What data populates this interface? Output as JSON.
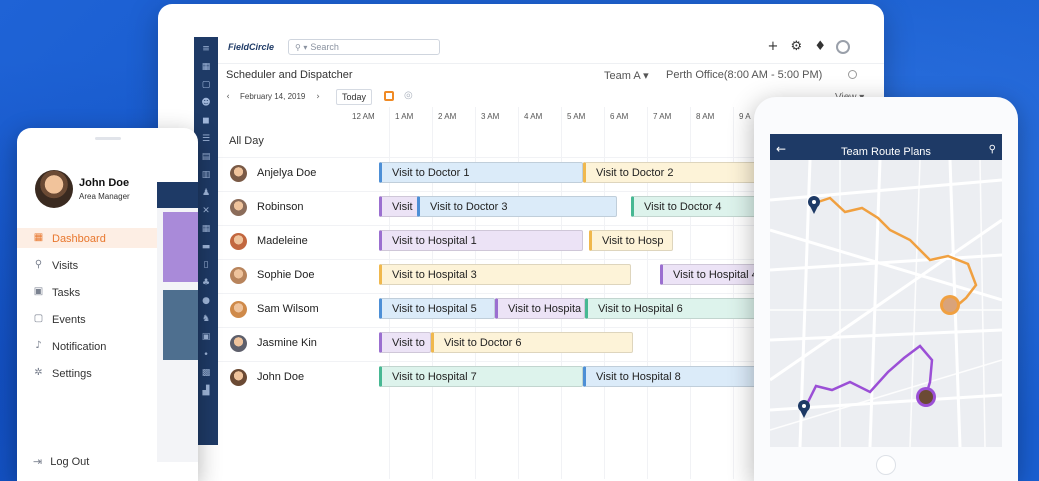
{
  "desktop": {
    "logo": "FieldCircle",
    "search_placeholder": "Search",
    "toolbar_icons": [
      "+",
      "⚙",
      "♦"
    ],
    "subtitle": "Scheduler and Dispatcher",
    "team": "Team A ▾",
    "office": "Perth Office(8:00 AM - 5:00 PM)",
    "date": "February 14, 2019",
    "today": "Today",
    "view": "View ▾",
    "hours": [
      "12 AM",
      "1 AM",
      "2 AM",
      "3 AM",
      "4 AM",
      "5 AM",
      "6 AM",
      "7 AM",
      "8 AM",
      "9 A"
    ],
    "all_day": "All Day",
    "rows": [
      {
        "name": "Anjelya Doe",
        "avatar_color": "#7a5a46",
        "events": [
          {
            "label": "Visit to Doctor 1",
            "color": "blue"
          },
          {
            "label": "Visit to Doctor 2",
            "color": "yellow"
          }
        ]
      },
      {
        "name": "Robinson",
        "avatar_color": "#8b6c5a",
        "events": [
          {
            "label": "Visit",
            "color": "purple"
          },
          {
            "label": "Visit to Doctor 3",
            "color": "blue"
          },
          {
            "label": "Visit to Doctor 4",
            "color": "green"
          }
        ]
      },
      {
        "name": "Madeleine",
        "avatar_color": "#c2673f",
        "events": [
          {
            "label": "Visit to Hospital 1",
            "color": "purple"
          },
          {
            "label": "Visit to Hosp",
            "color": "yellow"
          }
        ]
      },
      {
        "name": "Sophie Doe",
        "avatar_color": "#b8845c",
        "events": [
          {
            "label": "Visit to Hospital 3",
            "color": "yellow"
          },
          {
            "label": "Visit to Hospital 4",
            "color": "purple"
          }
        ]
      },
      {
        "name": "Sam Wilsom",
        "avatar_color": "#cf8a4a",
        "events": [
          {
            "label": "Visit to Hospital 5",
            "color": "blue"
          },
          {
            "label": "Visit to Hospita",
            "color": "purple"
          },
          {
            "label": "Visit to Hospital 6",
            "color": "green"
          }
        ]
      },
      {
        "name": "Jasmine Kin",
        "avatar_color": "#5e5f6b",
        "events": [
          {
            "label": "Visit to",
            "color": "purple"
          },
          {
            "label": "Visit to Doctor 6",
            "color": "yellow"
          }
        ]
      },
      {
        "name": "John Doe",
        "avatar_color": "#6b4a34",
        "events": [
          {
            "label": "Visit to Hospital 7",
            "color": "green"
          },
          {
            "label": "Visit to Hospital 8",
            "color": "blue"
          }
        ]
      }
    ]
  },
  "phone_left": {
    "user_name": "John Doe",
    "user_role": "Area Manager",
    "menu": [
      {
        "label": "Dashboard",
        "icon": "dashboard-icon",
        "active": true
      },
      {
        "label": "Visits",
        "icon": "location-pin-icon",
        "active": false
      },
      {
        "label": "Tasks",
        "icon": "tasks-icon",
        "active": false
      },
      {
        "label": "Events",
        "icon": "calendar-icon",
        "active": false
      },
      {
        "label": "Notification",
        "icon": "bell-icon",
        "active": false
      },
      {
        "label": "Settings",
        "icon": "gear-icon",
        "active": false
      }
    ],
    "logout": "Log Out"
  },
  "phone_right": {
    "title": "Team Route Plans"
  },
  "colors": {
    "navy": "#1e3a66",
    "accent_orange": "#e8772e",
    "route_orange": "#f0a040",
    "route_purple": "#9b4fd6"
  }
}
